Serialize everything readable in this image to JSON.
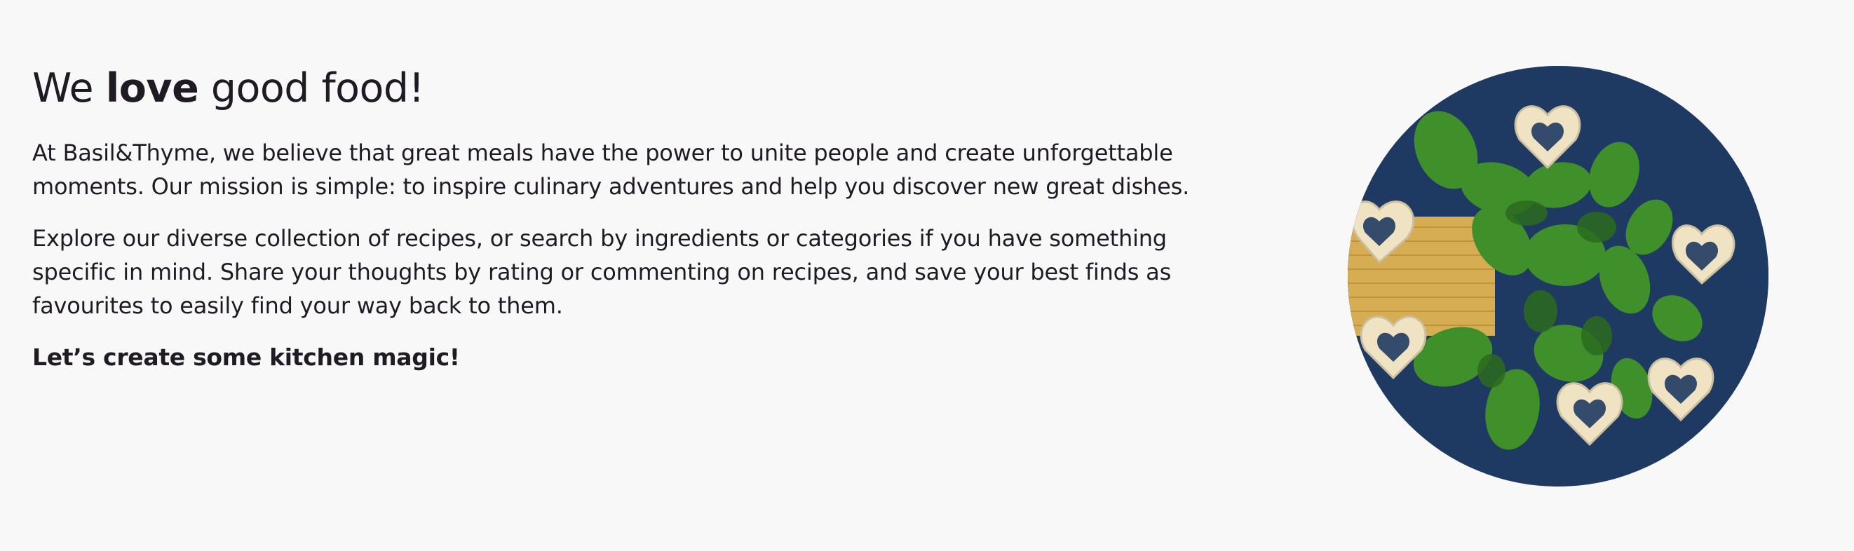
{
  "about": {
    "heading": {
      "before": "We ",
      "emphasis": "love",
      "after": " good food!"
    },
    "paragraphs": [
      "At Basil&Thyme, we believe that great meals have the power to unite people and create unforgettable moments. Our mission is simple: to inspire culinary adventures and help you discover new great dishes.",
      "Explore our diverse collection of recipes, or search by ingredients or categories if you have something specific in mind. Share your thoughts by rating or commenting on recipes, and save your best finds as favourites to easily find your way back to them."
    ],
    "cta": "Let’s create some kitchen magic!"
  },
  "image": {
    "subject": "basil-and-heart-pasta-photo",
    "colors": {
      "background": "#1f3a62",
      "basil": "#3f8f2b",
      "basil_dark": "#2b6b1d",
      "pasta": "#efe3c3",
      "spaghetti": "#d6ad52"
    }
  }
}
